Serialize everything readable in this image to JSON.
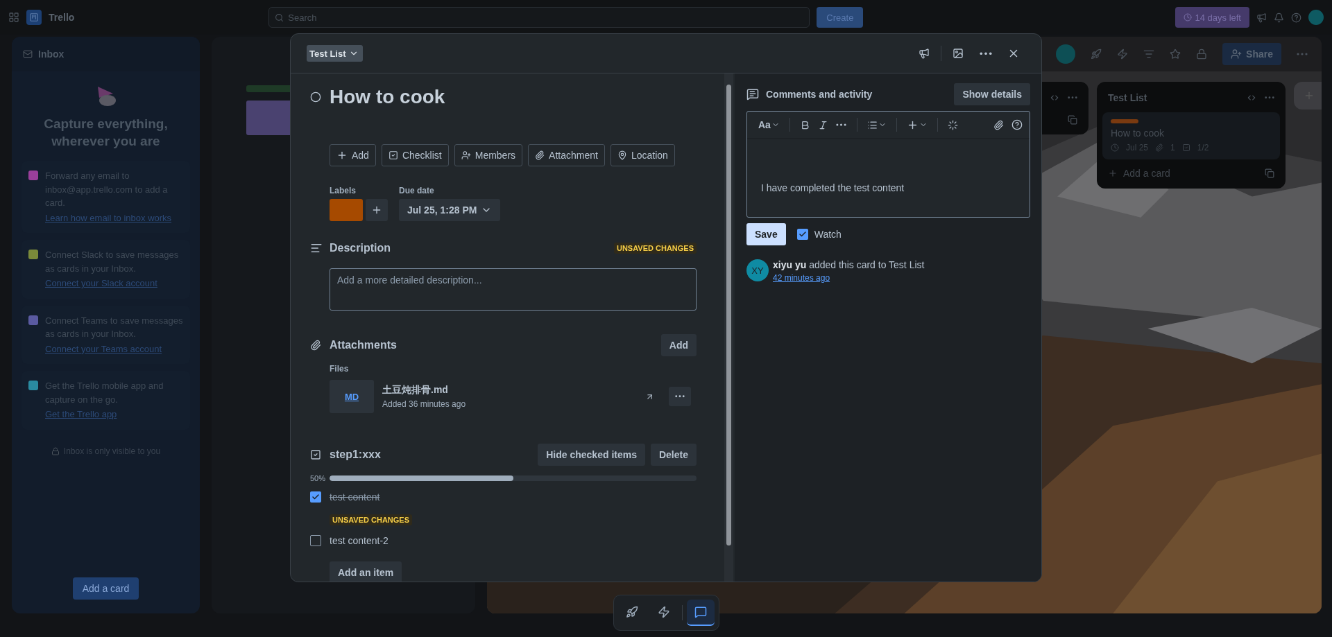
{
  "topbar": {
    "app_name": "Trello",
    "search_placeholder": "Search",
    "create_button": "Create",
    "trial_badge": "14 days left"
  },
  "inbox": {
    "title": "Inbox",
    "headline": "Capture everything, wherever you are",
    "tips": [
      {
        "text": "Forward any email to inbox@app.trello.com to add a card.",
        "link": "Learn how email to inbox works",
        "color": "#9a3f9a"
      },
      {
        "text": "Connect Slack to save messages as cards in your Inbox.",
        "link": "Connect your Slack account",
        "color": "#7a8a3a"
      },
      {
        "text": "Connect Teams to save messages as cards in your Inbox.",
        "link": "Connect your Teams account",
        "color": "#5a5aa0"
      },
      {
        "text": "Get the Trello mobile app and capture on the go.",
        "link": "Get the Trello app",
        "color": "#2a8aa0"
      }
    ],
    "privacy_note": "Inbox is only visible to you",
    "add_card": "Add a card"
  },
  "board": {
    "share_button": "Share",
    "list": {
      "title": "Test List",
      "cards": [
        {
          "title": "How to cook",
          "color": "#7a3a10",
          "due": "Jul 25",
          "attachments": "1",
          "checklist": "1/2"
        }
      ],
      "add_card": "Add a card"
    }
  },
  "dock": [
    {
      "kind": "rocket",
      "selected": false
    },
    {
      "kind": "bolt",
      "selected": false
    },
    {
      "kind": "comment",
      "selected": true
    }
  ],
  "card": {
    "list_button": "Test List",
    "title": "How to cook",
    "completed": false,
    "actions": [
      {
        "kind": "add",
        "label": "Add"
      },
      {
        "kind": "checklist",
        "label": "Checklist"
      },
      {
        "kind": "members",
        "label": "Members"
      },
      {
        "kind": "attachment",
        "label": "Attachment"
      },
      {
        "kind": "location",
        "label": "Location"
      }
    ],
    "labels": {
      "heading": "Labels",
      "items": [
        {
          "color": "#a64a00"
        }
      ]
    },
    "due_date": {
      "heading": "Due date",
      "value": "Jul 25, 1:28 PM"
    },
    "description": {
      "heading": "Description",
      "badge": "UNSAVED CHANGES",
      "placeholder": "Add a more detailed description..."
    },
    "attachments": {
      "heading": "Attachments",
      "add_button": "Add",
      "group": "Files",
      "files": [
        {
          "type": "MD",
          "name": "土豆炖排骨.md",
          "added": "Added 36 minutes ago"
        }
      ]
    },
    "checklist": {
      "title": "step1:xxx",
      "hide_button": "Hide checked items",
      "delete_button": "Delete",
      "percent": "50%",
      "level": 0.5,
      "items": [
        {
          "text": "test content",
          "checked": true,
          "badge": "UNSAVED CHANGES"
        },
        {
          "text": "test content-2",
          "checked": false
        }
      ],
      "add_item": "Add an item"
    }
  },
  "activity": {
    "heading": "Comments and activity",
    "details_button": "Show details",
    "text_style": "Aa",
    "comment": "I have completed the test content",
    "save_button": "Save",
    "watch": {
      "label": "Watch",
      "checked": true
    },
    "entries": [
      {
        "initials": "XY",
        "text": "**xiyu yu** added this card to Test List",
        "time": "42 minutes ago"
      }
    ]
  }
}
